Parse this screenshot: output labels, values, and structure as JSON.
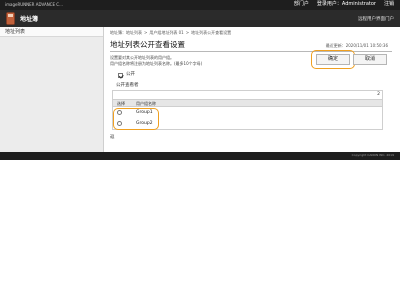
{
  "header": {
    "model": "imageRUNNER ADVANCE C...",
    "department_label": "部门户",
    "login_user_label": "登录用户：",
    "login_user": "Administrator",
    "logout_label": "注销",
    "app_title": "地址簿",
    "to_portal_label": "远程用户界面门户"
  },
  "sidebar": {
    "items": [
      {
        "label": "地址列表"
      }
    ]
  },
  "breadcrumb": [
    "地址簿：地址列表",
    "用户组地址列表 01",
    "地址列表公开查看设置"
  ],
  "page": {
    "title": "地址列表公开查看设置",
    "last_updated": "最近更新：2020/11/01 10:50:36",
    "desc_line1": "设置要对其公开地址列表的用户组。",
    "desc_line2": "用户组名称将注册为地址列表名称。(最多10个字母)",
    "ok_label": "确定",
    "cancel_label": "取消",
    "public_checkbox_label": "公开",
    "public_checked": true,
    "section_title": "公开查看者",
    "count": "2",
    "columns": {
      "select": "选择",
      "name": "用户组名称"
    },
    "groups": [
      {
        "name": "Group1",
        "selected": false
      },
      {
        "name": "Group2",
        "selected": false
      }
    ],
    "back_label": "返"
  },
  "footer": {
    "copyright": "Copyright CANON INC. 2019"
  },
  "colors": {
    "highlight": "#f0a020",
    "header_bg": "#1e1e1e",
    "titlebar_bg": "#2b2b2b"
  }
}
